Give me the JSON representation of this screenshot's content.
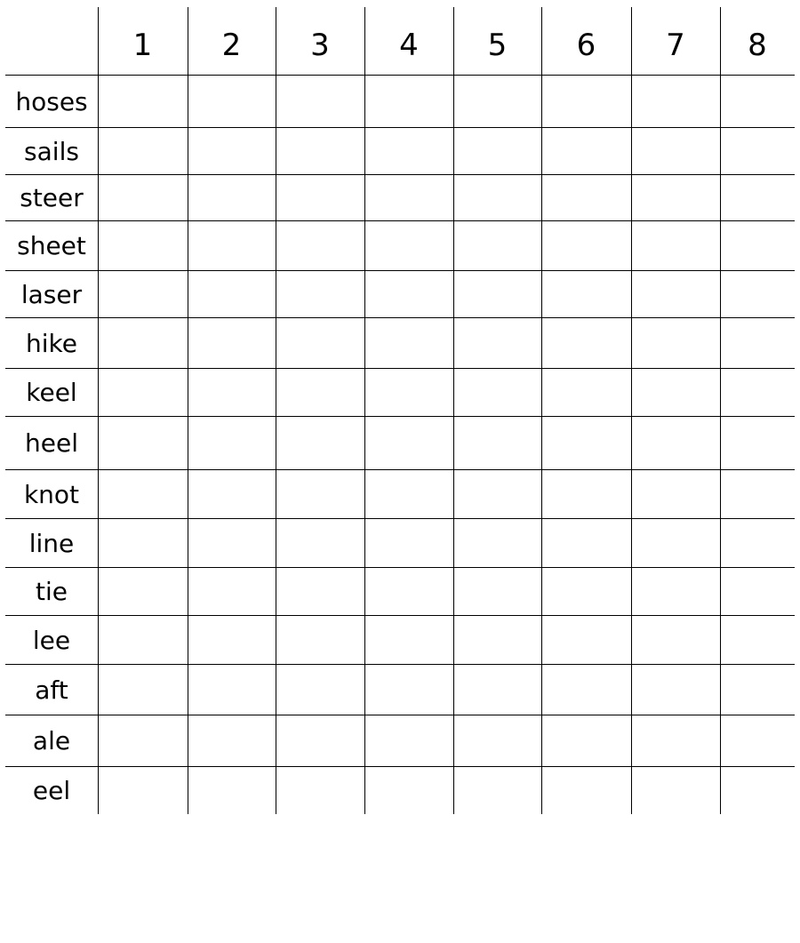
{
  "puzzle": {
    "columns": [
      "1",
      "2",
      "3",
      "4",
      "5",
      "6",
      "7",
      "8"
    ],
    "words": [
      "hoses",
      "sails",
      "steer",
      "sheet",
      "laser",
      "hike",
      "keel",
      "heel",
      "knot",
      "line",
      "tie",
      "lee",
      "aft",
      "ale",
      "eel"
    ]
  }
}
